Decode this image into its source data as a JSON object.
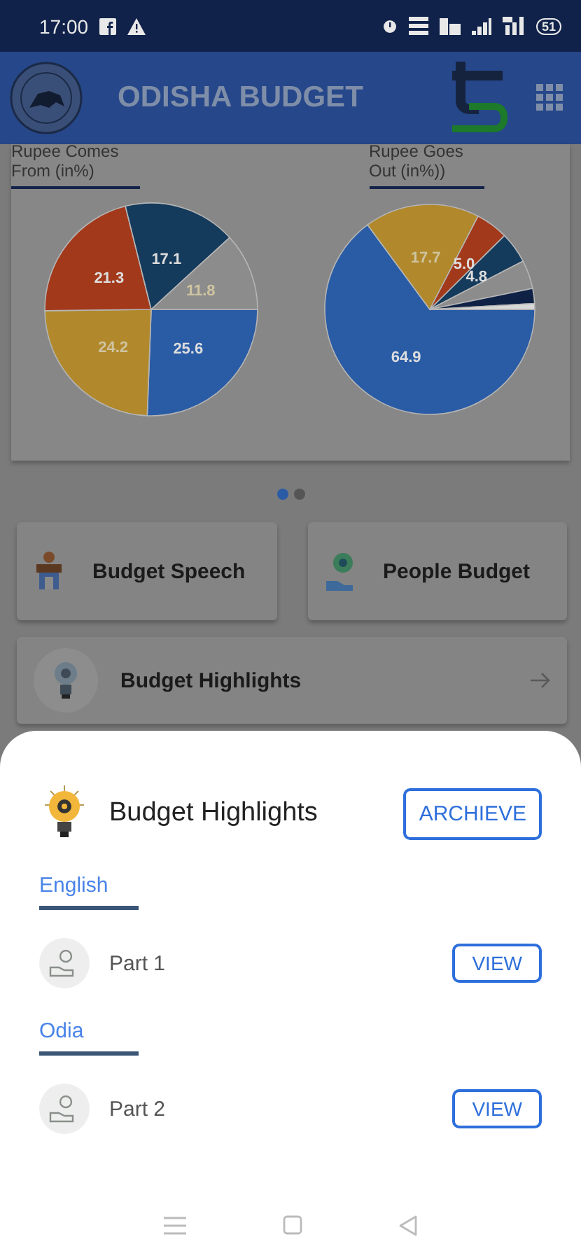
{
  "status_bar": {
    "time": "17:00",
    "battery": "51"
  },
  "app_bar": {
    "title": "ODISHA BUDGET"
  },
  "charts": [
    {
      "heading": "Rupee Comes From (in%)",
      "chart_data": {
        "type": "pie",
        "values": [
          25.6,
          24.2,
          21.3,
          17.1,
          11.8
        ],
        "value_labels": [
          "25.6",
          "24.2",
          "21.3",
          "17.1",
          "11.8"
        ]
      }
    },
    {
      "heading": "Rupee Goes Out (in%))",
      "chart_data": {
        "type": "pie",
        "values": [
          64.9,
          17.7,
          5.0,
          4.8,
          4.4,
          2.3,
          0.9
        ],
        "value_labels": [
          "64.9",
          "17.7",
          "5.0",
          "4.8",
          null,
          null,
          null
        ]
      }
    }
  ],
  "pager": [
    {
      "selected": true
    },
    {
      "selected": false
    }
  ],
  "feature_cards": [
    {
      "kind": "speech",
      "label": "Budget Speech"
    },
    {
      "kind": "people",
      "label": "People Budget"
    }
  ],
  "highlight_card": {
    "label": "Budget Highlights"
  },
  "sheet": {
    "title": "Budget Highlights",
    "archive_button": "ARCHIEVE",
    "sections": [
      {
        "heading": "English",
        "items": [
          {
            "label": "Part 1",
            "button": "VIEW"
          }
        ]
      },
      {
        "heading": "Odia",
        "items": [
          {
            "label": "Part 2",
            "button": "VIEW"
          }
        ]
      }
    ]
  }
}
